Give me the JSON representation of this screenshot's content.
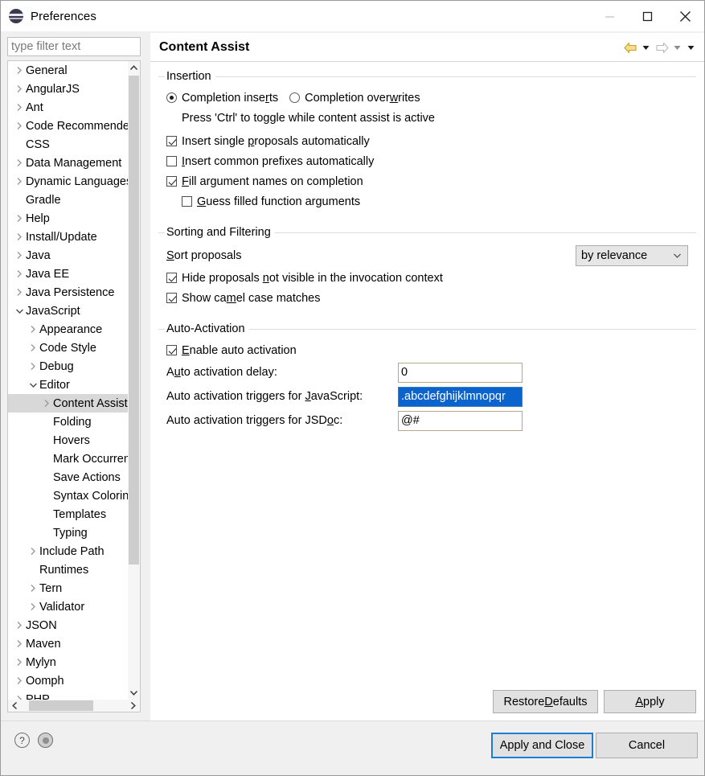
{
  "window": {
    "title": "Preferences",
    "app_icon": "eclipse-preferences-icon",
    "controls": {
      "minimize": "minimize-icon",
      "maximize": "maximize-icon",
      "close": "close-icon"
    }
  },
  "sidebar": {
    "filter_placeholder": "type filter text",
    "filter_value": "",
    "items": [
      {
        "label": "General",
        "indent": 0,
        "twisty": "collapsed",
        "selected": false
      },
      {
        "label": "AngularJS",
        "indent": 0,
        "twisty": "collapsed",
        "selected": false
      },
      {
        "label": "Ant",
        "indent": 0,
        "twisty": "collapsed",
        "selected": false
      },
      {
        "label": "Code Recommenders",
        "indent": 0,
        "twisty": "collapsed",
        "selected": false
      },
      {
        "label": "CSS",
        "indent": 0,
        "twisty": "none",
        "selected": false
      },
      {
        "label": "Data Management",
        "indent": 0,
        "twisty": "collapsed",
        "selected": false
      },
      {
        "label": "Dynamic Languages",
        "indent": 0,
        "twisty": "collapsed",
        "selected": false
      },
      {
        "label": "Gradle",
        "indent": 0,
        "twisty": "none",
        "selected": false
      },
      {
        "label": "Help",
        "indent": 0,
        "twisty": "collapsed",
        "selected": false
      },
      {
        "label": "Install/Update",
        "indent": 0,
        "twisty": "collapsed",
        "selected": false
      },
      {
        "label": "Java",
        "indent": 0,
        "twisty": "collapsed",
        "selected": false
      },
      {
        "label": "Java EE",
        "indent": 0,
        "twisty": "collapsed",
        "selected": false
      },
      {
        "label": "Java Persistence",
        "indent": 0,
        "twisty": "collapsed",
        "selected": false
      },
      {
        "label": "JavaScript",
        "indent": 0,
        "twisty": "expanded",
        "selected": false
      },
      {
        "label": "Appearance",
        "indent": 1,
        "twisty": "collapsed",
        "selected": false
      },
      {
        "label": "Code Style",
        "indent": 1,
        "twisty": "collapsed",
        "selected": false
      },
      {
        "label": "Debug",
        "indent": 1,
        "twisty": "collapsed",
        "selected": false
      },
      {
        "label": "Editor",
        "indent": 1,
        "twisty": "expanded",
        "selected": false
      },
      {
        "label": "Content Assist",
        "indent": 2,
        "twisty": "collapsed",
        "selected": true
      },
      {
        "label": "Folding",
        "indent": 2,
        "twisty": "none",
        "selected": false
      },
      {
        "label": "Hovers",
        "indent": 2,
        "twisty": "none",
        "selected": false
      },
      {
        "label": "Mark Occurrences",
        "indent": 2,
        "twisty": "none",
        "selected": false
      },
      {
        "label": "Save Actions",
        "indent": 2,
        "twisty": "none",
        "selected": false
      },
      {
        "label": "Syntax Coloring",
        "indent": 2,
        "twisty": "none",
        "selected": false
      },
      {
        "label": "Templates",
        "indent": 2,
        "twisty": "none",
        "selected": false
      },
      {
        "label": "Typing",
        "indent": 2,
        "twisty": "none",
        "selected": false
      },
      {
        "label": "Include Path",
        "indent": 1,
        "twisty": "collapsed",
        "selected": false
      },
      {
        "label": "Runtimes",
        "indent": 1,
        "twisty": "none",
        "selected": false
      },
      {
        "label": "Tern",
        "indent": 1,
        "twisty": "collapsed",
        "selected": false
      },
      {
        "label": "Validator",
        "indent": 1,
        "twisty": "collapsed",
        "selected": false
      },
      {
        "label": "JSON",
        "indent": 0,
        "twisty": "collapsed",
        "selected": false
      },
      {
        "label": "Maven",
        "indent": 0,
        "twisty": "collapsed",
        "selected": false
      },
      {
        "label": "Mylyn",
        "indent": 0,
        "twisty": "collapsed",
        "selected": false
      },
      {
        "label": "Oomph",
        "indent": 0,
        "twisty": "collapsed",
        "selected": false
      },
      {
        "label": "PHP",
        "indent": 0,
        "twisty": "collapsed",
        "selected": false
      }
    ]
  },
  "page": {
    "title": "Content Assist",
    "nav": {
      "back_icon": "back-arrow-icon",
      "back_caret_icon": "chevron-down-icon",
      "forward_icon": "forward-arrow-icon",
      "forward_caret_icon": "chevron-down-icon",
      "menu_caret_icon": "chevron-down-icon"
    },
    "insertion": {
      "title": "Insertion",
      "radio_inserts": {
        "pre": "Completion inse",
        "mnemonic": "r",
        "post": "ts",
        "checked": true
      },
      "radio_overwrites": {
        "pre": "Completion over",
        "mnemonic": "w",
        "post": "rites",
        "checked": false
      },
      "hint": "Press 'Ctrl' to toggle while content assist is active",
      "check_single": {
        "pre": "Insert single ",
        "mnemonic": "p",
        "post": "roposals automatically",
        "checked": true
      },
      "check_prefixes": {
        "pre": "",
        "mnemonic": "I",
        "post": "nsert common prefixes automatically",
        "checked": false
      },
      "check_fill": {
        "pre": "",
        "mnemonic": "F",
        "post": "ill argument names on completion",
        "checked": true
      },
      "check_guess": {
        "pre": "",
        "mnemonic": "G",
        "post": "uess filled function arguments",
        "checked": false
      }
    },
    "sorting": {
      "title": "Sorting and Filtering",
      "sort_label": {
        "pre": "",
        "mnemonic": "S",
        "post": "ort proposals"
      },
      "sort_value": "by relevance",
      "sort_options": [
        "by relevance"
      ],
      "check_hide": {
        "pre": "Hide proposals ",
        "mnemonic": "n",
        "post": "ot visible in the invocation context",
        "checked": true
      },
      "check_camel": {
        "pre": "Show ca",
        "mnemonic": "m",
        "post": "el case matches",
        "checked": true
      }
    },
    "auto_activation": {
      "title": "Auto-Activation",
      "check_enable": {
        "pre": "",
        "mnemonic": "E",
        "post": "nable auto activation",
        "checked": true
      },
      "delay_label": {
        "pre": "A",
        "mnemonic": "u",
        "post": "to activation delay:"
      },
      "delay_value": "0",
      "js_label": {
        "pre": "Auto activation triggers for ",
        "mnemonic": "J",
        "post": "avaScript:"
      },
      "js_value": ".abcdefghijklmnopqr",
      "js_selected": true,
      "jsdoc_label": {
        "pre": "Auto activation triggers for JSD",
        "mnemonic": "o",
        "post": "c:"
      },
      "jsdoc_value": "@#"
    },
    "footer": {
      "restore_defaults": {
        "pre": "Restore ",
        "mnemonic": "D",
        "post": "efaults"
      },
      "apply": {
        "pre": "",
        "mnemonic": "A",
        "post": "pply"
      }
    }
  },
  "dialog_footer": {
    "help_icon": "help-icon",
    "secondary_icon": "record-icon",
    "apply_and_close": "Apply and Close",
    "cancel": "Cancel"
  },
  "colors": {
    "accent_focus": "#1a7fd4",
    "selection_blue": "#0b63ce",
    "tree_selection": "#d8d8d8",
    "back_arrow": "#e8c14a"
  }
}
